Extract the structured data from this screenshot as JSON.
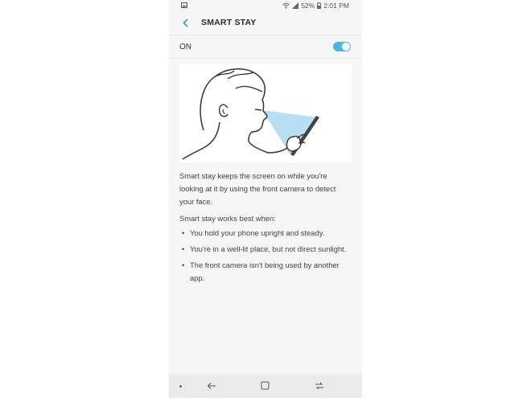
{
  "status_bar": {
    "battery": "52%",
    "time": "2:01 PM"
  },
  "header": {
    "title": "SMART STAY"
  },
  "switch_row": {
    "label": "ON",
    "enabled": true
  },
  "colors": {
    "accent": "#4fb6e3",
    "beam": "#b8e0f2"
  },
  "illustration": {
    "icon": "person-looking-at-phone-illustration"
  },
  "content": {
    "intro": "Smart stay keeps the screen on while you're looking at it by using the front camera to detect your face.",
    "best_when": "Smart stay works best when:",
    "tips": [
      "You hold your phone upright and steady.",
      "You're in a well-lit place, but not direct sunlight.",
      "The front camera isn't being used by another app."
    ],
    "bullet": "•"
  },
  "nav_bar": {
    "icons": [
      "dot-icon",
      "back-icon",
      "home-icon",
      "recent-apps-icon"
    ]
  }
}
